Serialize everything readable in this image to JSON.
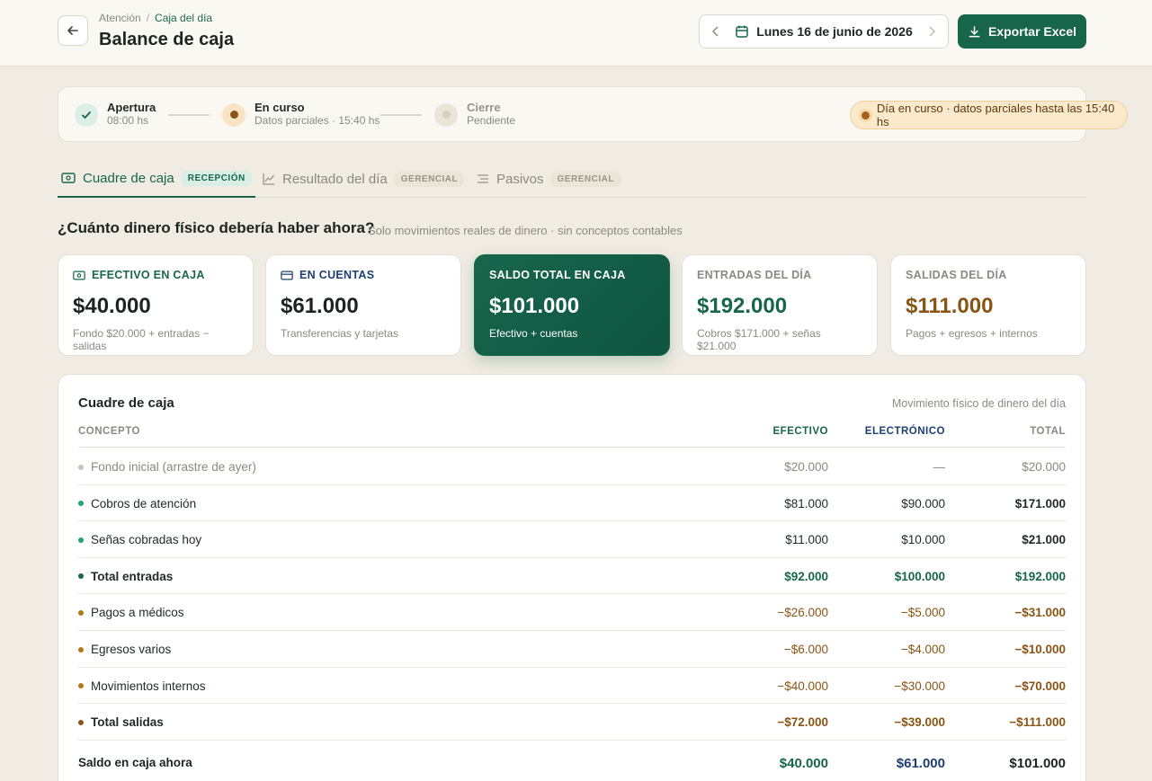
{
  "header": {
    "breadcrumb": [
      "Atención",
      "Caja del día"
    ],
    "breadcrumb_sep": "/",
    "title": "Balance de caja",
    "date": "Lunes 16 de junio de 2026",
    "export_label": "Exportar Excel"
  },
  "status": {
    "steps": [
      {
        "label": "Apertura",
        "sub": "08:00 hs",
        "state": "done"
      },
      {
        "label": "En curso",
        "sub": "Datos parciales · 15:40 hs",
        "state": "current"
      },
      {
        "label": "Cierre",
        "sub": "Pendiente",
        "state": "pending"
      }
    ],
    "pill": "Día en curso · datos parciales hasta las 15:40 hs"
  },
  "tabs": [
    {
      "label": "Cuadre de caja",
      "badge": "RECEPCIÓN",
      "active": true,
      "icon": "cash-icon"
    },
    {
      "label": "Resultado del día",
      "badge": "GERENCIAL",
      "active": false,
      "icon": "chart-icon"
    },
    {
      "label": "Pasivos",
      "badge": "GERENCIAL",
      "active": false,
      "icon": "list-icon"
    }
  ],
  "question": {
    "title": "¿Cuánto dinero físico debería haber ahora?",
    "subtitle": "Solo movimientos reales de dinero · sin conceptos contables"
  },
  "cards": [
    {
      "title": "EFECTIVO EN CAJA",
      "value": "$40.000",
      "sub": "Fondo $20.000 + entradas − salidas",
      "icon": "cash-icon"
    },
    {
      "title": "EN CUENTAS",
      "value": "$61.000",
      "sub": "Transferencias y tarjetas",
      "icon": "card-icon"
    },
    {
      "title": "SALDO TOTAL EN CAJA",
      "value": "$101.000",
      "sub": "Efectivo + cuentas"
    },
    {
      "title": "ENTRADAS DEL DÍA",
      "value": "$192.000",
      "sub": "Cobros $171.000 + señas $21.000"
    },
    {
      "title": "SALIDAS DEL DÍA",
      "value": "$111.000",
      "sub": "Pagos + egresos + internos"
    }
  ],
  "table": {
    "title": "Cuadre de caja",
    "note": "Movimiento físico de dinero del día",
    "headers": {
      "concept": "CONCEPTO",
      "cash": "EFECTIVO",
      "electronic": "ELECTRÓNICO",
      "total": "TOTAL"
    },
    "rows": [
      {
        "concept": "Fondo inicial (arrastre de ayer)",
        "cash": "$20.000",
        "electronic": "—",
        "total": "$20.000",
        "kind": "muted"
      },
      {
        "concept": "Cobros de atención",
        "cash": "$81.000",
        "electronic": "$90.000",
        "total": "$171.000",
        "kind": "in"
      },
      {
        "concept": "Señas cobradas hoy",
        "cash": "$11.000",
        "electronic": "$10.000",
        "total": "$21.000",
        "kind": "in"
      },
      {
        "concept": "Total entradas",
        "cash": "$92.000",
        "electronic": "$100.000",
        "total": "$192.000",
        "kind": "in-total"
      },
      {
        "concept": "Pagos a médicos",
        "cash": "−$26.000",
        "electronic": "−$5.000",
        "total": "−$31.000",
        "kind": "out"
      },
      {
        "concept": "Egresos varios",
        "cash": "−$6.000",
        "electronic": "−$4.000",
        "total": "−$10.000",
        "kind": "out"
      },
      {
        "concept": "Movimientos internos",
        "cash": "−$40.000",
        "electronic": "−$30.000",
        "total": "−$70.000",
        "kind": "out"
      },
      {
        "concept": "Total salidas",
        "cash": "−$72.000",
        "electronic": "−$39.000",
        "total": "−$111.000",
        "kind": "out-total"
      }
    ],
    "footer": {
      "concept": "Saldo en caja ahora",
      "cash": "$40.000",
      "electronic": "$61.000",
      "total": "$101.000"
    }
  },
  "colors": {
    "primary": "#17664c",
    "blue": "#1d3f73",
    "amber": "#8a5414",
    "background": "#f1ece3"
  }
}
